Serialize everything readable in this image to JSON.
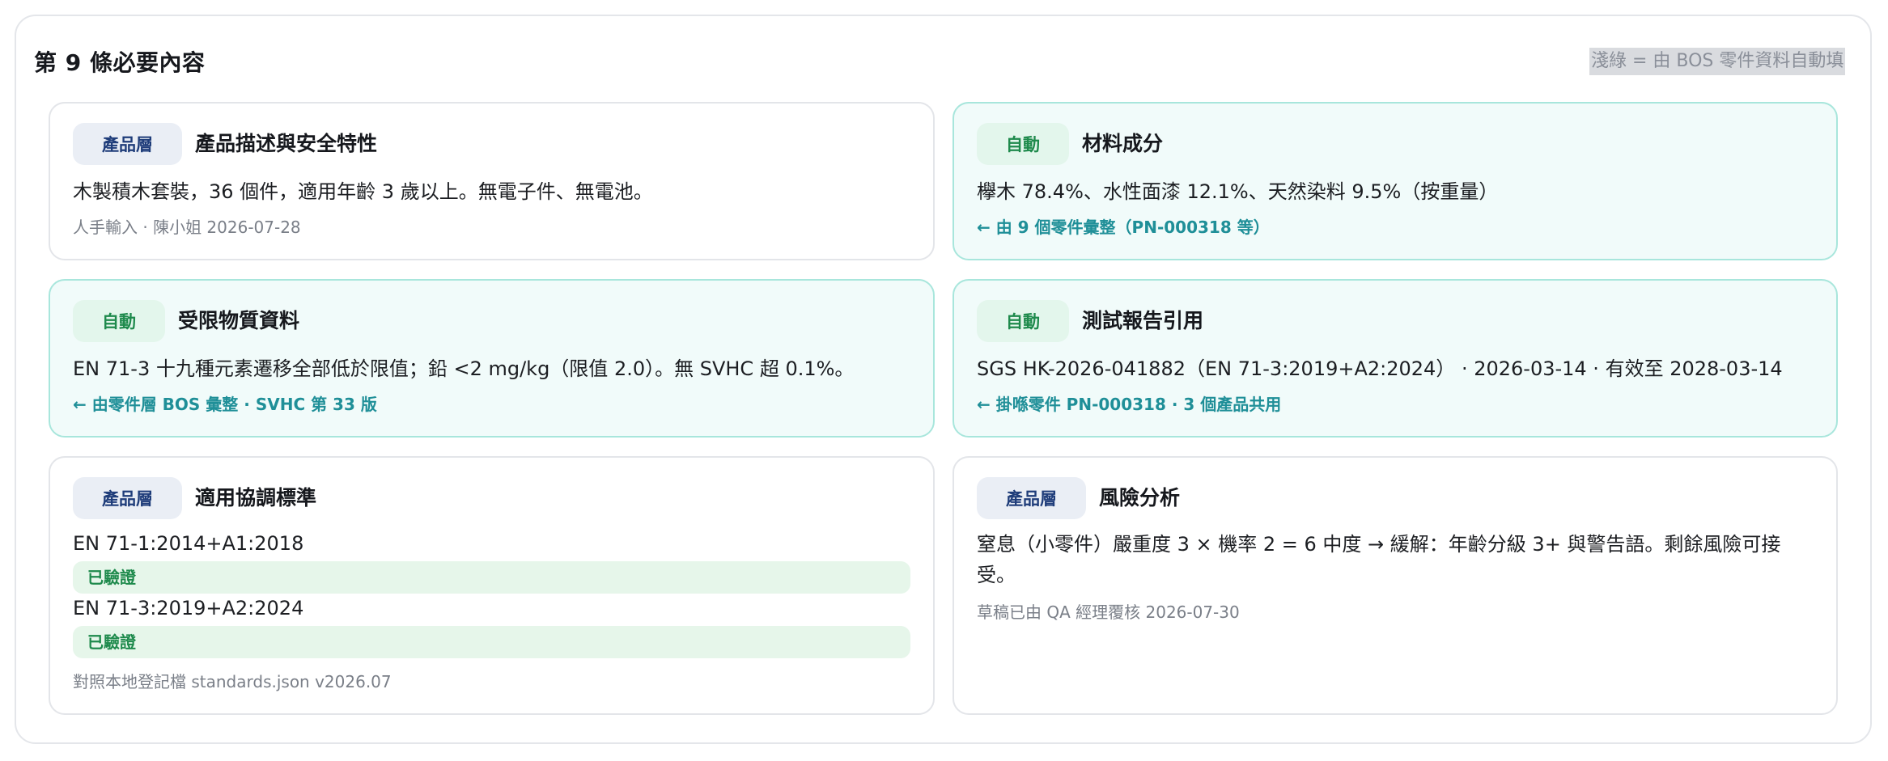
{
  "panel": {
    "title": "第 9 條必要內容",
    "legend_note": "淺綠 = 由 BOS 零件資料自動填"
  },
  "cards": {
    "product_description": {
      "badge": "產品層",
      "title": "產品描述與安全特性",
      "body": "木製積木套裝，36 個件，適用年齡 3 歲以上。無電子件、無電池。",
      "meta": "人手輸入 · 陳小姐 2026-07-28"
    },
    "material_composition": {
      "badge": "自動",
      "title": "材料成分",
      "body": "欅木 78.4%、水性面漆 12.1%、天然染料 9.5%（按重量）",
      "link": "← 由 9 個零件彙整（PN-000318 等）"
    },
    "restricted_substances": {
      "badge": "自動",
      "title": "受限物質資料",
      "body": "EN 71-3 十九種元素遷移全部低於限值；鉛 <2 mg/kg（限值 2.0）。無 SVHC 超 0.1%。",
      "link": "← 由零件層 BOS 彙整 · SVHC 第 33 版"
    },
    "test_report": {
      "badge": "自動",
      "title": "測試報告引用",
      "body": "SGS HK-2026-041882（EN 71-3:2019+A2:2024） · 2026-03-14 · 有效至 2028-03-14",
      "link": "← 掛喺零件 PN-000318 · 3 個產品共用"
    },
    "harmonised_standards": {
      "badge": "產品層",
      "title": "適用協調標準",
      "standards": [
        {
          "name": "EN 71-1:2014+A1:2018",
          "status": "已驗證"
        },
        {
          "name": "EN 71-3:2019+A2:2024",
          "status": "已驗證"
        }
      ],
      "meta": "對照本地登記檔 standards.json v2026.07"
    },
    "risk_analysis": {
      "badge": "產品層",
      "title": "風險分析",
      "body": "窒息（小零件）嚴重度 3 × 機率 2 = 6 中度 → 緩解：年齡分級 3+ 與警告語。剩餘風險可接受。",
      "meta": "草稿已由 QA 經理覆核 2026-07-30"
    }
  },
  "colors": {
    "auto_fill_background": "#f1fbfa",
    "auto_fill_border": "#a8e6dc",
    "link_teal": "#1f8f98",
    "verified_green": "#1e8a4c",
    "product_badge_navy": "#1f3d7a"
  }
}
